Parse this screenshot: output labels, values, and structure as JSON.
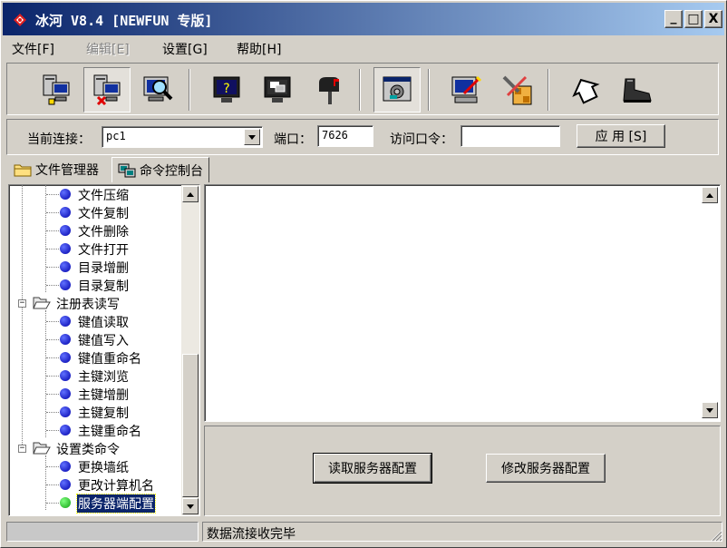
{
  "window": {
    "title": "冰河 V8.4 [NEWFUN 专版]",
    "minimize_label": "_",
    "maximize_label": "□",
    "close_label": "X"
  },
  "menu": {
    "items": [
      {
        "label": "文件[F]",
        "enabled": true
      },
      {
        "label": "编辑[E]",
        "enabled": false
      },
      {
        "label": "设置[G]",
        "enabled": true
      },
      {
        "label": "帮助[H]",
        "enabled": true
      }
    ]
  },
  "toolbar": {
    "buttons": [
      {
        "icon": "add-host-icon"
      },
      {
        "icon": "delete-host-icon",
        "pressed": true
      },
      {
        "icon": "search-computer-icon"
      },
      {
        "icon": "help-monitor-icon"
      },
      {
        "icon": "screen-capture-icon"
      },
      {
        "icon": "mailbox-icon"
      },
      {
        "icon": "control-panel-icon",
        "pressed": true
      },
      {
        "icon": "edit-monitor-icon"
      },
      {
        "icon": "config-tools-icon"
      },
      {
        "icon": "home-icon"
      },
      {
        "icon": "exit-boot-icon"
      }
    ]
  },
  "connection": {
    "current_label": "当前连接：",
    "current_value": "pc1",
    "port_label": "端口：",
    "port_value": "7626",
    "password_label": "访问口令：",
    "password_value": "",
    "apply_label": "应 用 [S]"
  },
  "tabs": [
    {
      "label": "文件管理器",
      "icon": "folder-icon",
      "active": false
    },
    {
      "label": "命令控制台",
      "icon": "console-icon",
      "active": true
    }
  ],
  "tree": {
    "items": [
      {
        "label": "文件压缩",
        "level": 2,
        "type": "blue"
      },
      {
        "label": "文件复制",
        "level": 2,
        "type": "blue"
      },
      {
        "label": "文件删除",
        "level": 2,
        "type": "blue"
      },
      {
        "label": "文件打开",
        "level": 2,
        "type": "blue"
      },
      {
        "label": "目录增删",
        "level": 2,
        "type": "blue"
      },
      {
        "label": "目录复制",
        "level": 2,
        "type": "blue"
      },
      {
        "label": "注册表读写",
        "level": 1,
        "type": "folder"
      },
      {
        "label": "键值读取",
        "level": 2,
        "type": "blue"
      },
      {
        "label": "键值写入",
        "level": 2,
        "type": "blue"
      },
      {
        "label": "键值重命名",
        "level": 2,
        "type": "blue"
      },
      {
        "label": "主键浏览",
        "level": 2,
        "type": "blue"
      },
      {
        "label": "主键增删",
        "level": 2,
        "type": "blue"
      },
      {
        "label": "主键复制",
        "level": 2,
        "type": "blue"
      },
      {
        "label": "主键重命名",
        "level": 2,
        "type": "blue"
      },
      {
        "label": "设置类命令",
        "level": 1,
        "type": "folder"
      },
      {
        "label": "更换墙纸",
        "level": 2,
        "type": "blue"
      },
      {
        "label": "更改计算机名",
        "level": 2,
        "type": "blue"
      },
      {
        "label": "服务器端配置",
        "level": 2,
        "type": "green",
        "selected": true
      }
    ]
  },
  "command_panel": {
    "read_config_label": "读取服务器配置",
    "modify_config_label": "修改服务器配置"
  },
  "status": {
    "left_text": "",
    "message": "数据流接收完毕"
  },
  "colors": {
    "title_start": "#0a246a",
    "title_end": "#a6caf0",
    "face": "#d4d0c8",
    "node_blue": "#0000cc",
    "node_green": "#22aa22",
    "selection": "#0a246a"
  }
}
